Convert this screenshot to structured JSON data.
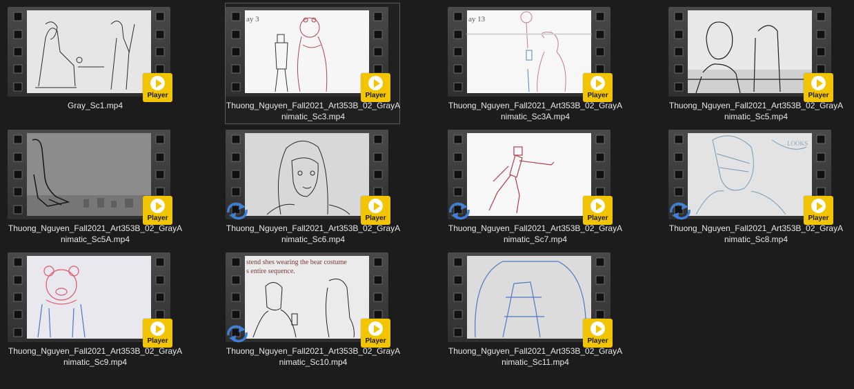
{
  "colors": {
    "background": "#1c1c1c",
    "player_badge": "#f2c500",
    "sync_icon": "#3f7fd6"
  },
  "player_badge_label": "Player",
  "files": [
    {
      "line1": "Gray_Sc1.mp4",
      "line2": "",
      "selected": false,
      "sync": false,
      "scene": "sc1"
    },
    {
      "line1": "Thuong_Nguyen_Fall2021_Art353B_02_GrayA",
      "line2": "nimatic_Sc3.mp4",
      "selected": true,
      "sync": false,
      "scene": "sc3",
      "thumb_text": "ay 3"
    },
    {
      "line1": "Thuong_Nguyen_Fall2021_Art353B_02_GrayA",
      "line2": "nimatic_Sc3A.mp4",
      "selected": false,
      "sync": false,
      "scene": "sc3a",
      "thumb_text": "ay 13"
    },
    {
      "line1": "Thuong_Nguyen_Fall2021_Art353B_02_GrayA",
      "line2": "nimatic_Sc5.mp4",
      "selected": false,
      "sync": false,
      "scene": "sc5"
    },
    {
      "line1": "Thuong_Nguyen_Fall2021_Art353B_02_GrayA",
      "line2": "nimatic_Sc5A.mp4",
      "selected": false,
      "sync": false,
      "scene": "sc5a"
    },
    {
      "line1": "Thuong_Nguyen_Fall2021_Art353B_02_GrayA",
      "line2": "nimatic_Sc6.mp4",
      "selected": false,
      "sync": true,
      "scene": "sc6"
    },
    {
      "line1": "Thuong_Nguyen_Fall2021_Art353B_02_GrayA",
      "line2": "nimatic_Sc7.mp4",
      "selected": false,
      "sync": true,
      "scene": "sc7"
    },
    {
      "line1": "Thuong_Nguyen_Fall2021_Art353B_02_GrayA",
      "line2": "nimatic_Sc8.mp4",
      "selected": false,
      "sync": true,
      "scene": "sc8"
    },
    {
      "line1": "Thuong_Nguyen_Fall2021_Art353B_02_GrayA",
      "line2": "nimatic_Sc9.mp4",
      "selected": false,
      "sync": false,
      "scene": "sc9"
    },
    {
      "line1": "Thuong_Nguyen_Fall2021_Art353B_02_GrayA",
      "line2": "nimatic_Sc10.mp4",
      "selected": false,
      "sync": true,
      "scene": "sc10",
      "thumb_text": "stend shes wearing the bear costume",
      "thumb_text2": "s entire sequence."
    },
    {
      "line1": "Thuong_Nguyen_Fall2021_Art353B_02_GrayA",
      "line2": "nimatic_Sc11.mp4",
      "selected": false,
      "sync": false,
      "scene": "sc11"
    }
  ]
}
